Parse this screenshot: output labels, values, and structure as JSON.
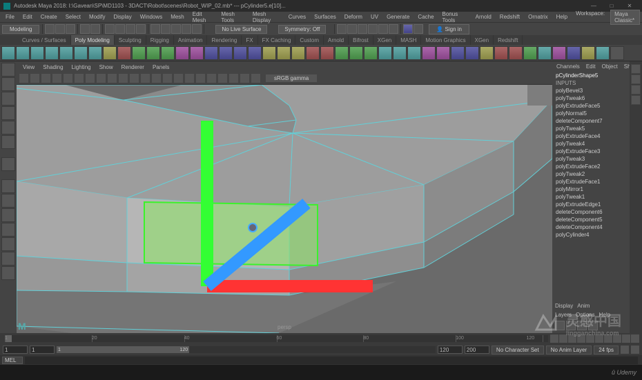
{
  "titlebar": {
    "title": "Autodesk Maya 2018: I:\\Gavean\\SP\\MD1103 - 3DACT\\Robot\\scenes\\Robot_WIP_02.mb*  ---  pCylinder5.e[10]..."
  },
  "menubar": {
    "items": [
      "File",
      "Edit",
      "Create",
      "Select",
      "Modify",
      "Display",
      "Windows",
      "Mesh",
      "Edit Mesh",
      "Mesh Tools",
      "Mesh Display",
      "Curves",
      "Surfaces",
      "Deform",
      "UV",
      "Generate",
      "Cache",
      "Bonus Tools",
      "Arnold",
      "Redshift",
      "Ornatrix",
      "Help"
    ],
    "workspace_label": "Workspace:",
    "workspace_value": "Maya Classic*"
  },
  "statusline": {
    "mode": "Modeling",
    "nolive": "No Live Surface",
    "symmetry": "Symmetry: Off",
    "signin": "Sign in"
  },
  "shelf": {
    "tabs": [
      "Curves / Surfaces",
      "Poly Modeling",
      "Sculpting",
      "Rigging",
      "Animation",
      "Rendering",
      "FX",
      "FX Caching",
      "Custom",
      "Arnold",
      "Bifrost",
      "XGen",
      "MASH",
      "Motion Graphics",
      "XGen",
      "Redshift"
    ]
  },
  "panel_menus": [
    "View",
    "Shading",
    "Lighting",
    "Show",
    "Renderer",
    "Panels"
  ],
  "renderer_dd": "sRGB gamma",
  "camera_label": "persp",
  "channel_box": {
    "tabs": [
      "Channels",
      "Edit",
      "Object",
      "Show"
    ],
    "shape": "pCylinderShape5",
    "section": "INPUTS",
    "items": [
      "polyBevel3",
      "polyTweak6",
      "polyExtrudeFace5",
      "polyNormal5",
      "deleteComponent7",
      "polyTweak5",
      "polyExtrudeFace4",
      "polyTweak4",
      "polyExtrudeFace3",
      "polyTweak3",
      "polyExtrudeFace2",
      "polyTweak2",
      "polyExtrudeFace1",
      "polyMirror1",
      "polyTweak1",
      "polyExtrudeEdge1",
      "deleteComponent6",
      "deleteComponent5",
      "deleteComponent4",
      "polyCylinder4"
    ]
  },
  "display_panel": {
    "header": [
      "Display",
      "Anim"
    ],
    "tabs": [
      "Layers",
      "Options",
      "Help"
    ]
  },
  "time": {
    "ticks": [
      "1",
      "20",
      "40",
      "60",
      "80",
      "100",
      "120"
    ]
  },
  "range": {
    "start": "1",
    "sub_start": "1",
    "sub_end": "120",
    "end": "200",
    "charset": "No Character Set",
    "animlayer": "No Anim Layer",
    "fps": "24 fps"
  },
  "cmd": {
    "lang": "MEL"
  },
  "bottom": {
    "logo": "Udemy"
  },
  "watermark": {
    "brand": "灵感中国",
    "sub": "lingganchina.com"
  }
}
